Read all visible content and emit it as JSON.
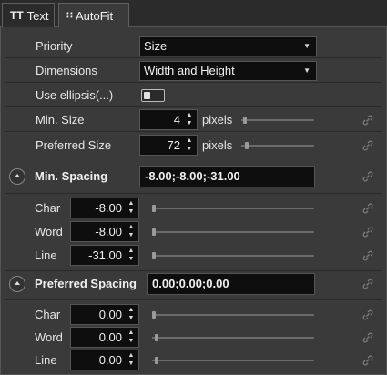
{
  "tabs": [
    {
      "glyph": "TT",
      "label": "Text"
    },
    {
      "glyph": "∷",
      "label": "AutoFit"
    }
  ],
  "priority": {
    "label": "Priority",
    "value": "Size"
  },
  "dimensions": {
    "label": "Dimensions",
    "value": "Width and Height"
  },
  "ellipsis": {
    "label": "Use ellipsis(...)",
    "on": false
  },
  "min_size": {
    "label": "Min. Size",
    "value": "4",
    "unit": "pixels",
    "slider_fraction": 0.02
  },
  "preferred_size": {
    "label": "Preferred Size",
    "value": "72",
    "unit": "pixels",
    "slider_fraction": 0.05
  },
  "min_spacing": {
    "label": "Min. Spacing",
    "value": "-8.00;-8.00;-31.00",
    "rows": [
      {
        "label": "Char",
        "value": "-8.00",
        "slider_fraction": 0.0
      },
      {
        "label": "Word",
        "value": "-8.00",
        "slider_fraction": 0.0
      },
      {
        "label": "Line",
        "value": "-31.00",
        "slider_fraction": 0.0
      }
    ]
  },
  "preferred_spacing": {
    "label": "Preferred Spacing",
    "value": "0.00;0.00;0.00",
    "rows": [
      {
        "label": "Char",
        "value": "0.00",
        "slider_fraction": 0.0
      },
      {
        "label": "Word",
        "value": "0.00",
        "slider_fraction": 0.02
      },
      {
        "label": "Line",
        "value": "0.00",
        "slider_fraction": 0.02
      }
    ]
  }
}
